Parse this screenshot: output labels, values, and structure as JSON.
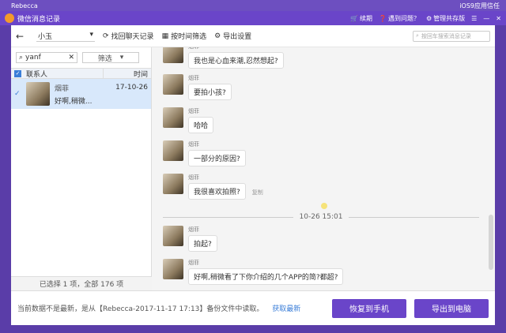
{
  "mac_bar": {
    "app": "Rebecca",
    "right_text": "iOS9应用信任"
  },
  "titlebar": {
    "title": "微信消息记录",
    "items": [
      {
        "label": "续期",
        "icon": "cart-icon"
      },
      {
        "label": "遇到问题？",
        "icon": "help-icon"
      },
      {
        "label": "管理共存版",
        "icon": "manage-icon"
      }
    ]
  },
  "toolbar": {
    "contact": "小玉",
    "retrieve_label": "找回聊天记录",
    "time_filter_label": "按时间筛选",
    "export_label": "导出设置",
    "search_placeholder": "按回车搜索消息记录"
  },
  "left": {
    "search_value": "yanf",
    "filter_label": "筛选",
    "col_contact": "联系人",
    "col_time": "时间",
    "rows": [
      {
        "name": "烟菲",
        "preview": "好啊,稍微...",
        "time": "17-10-26"
      }
    ],
    "footer": "已选择 1 项，全部 176 项"
  },
  "chat": {
    "divider_time": "10-26 15:01",
    "copy_label": "复制",
    "messages": [
      {
        "name": "烟菲",
        "text": "我也是心血来潮,忍然想起?"
      },
      {
        "name": "烟菲",
        "text": "要拍小孩?"
      },
      {
        "name": "烟菲",
        "text": "哈哈"
      },
      {
        "name": "烟菲",
        "text": "一部分的原因?"
      },
      {
        "name": "烟菲",
        "text": "我很喜欢拍照?"
      },
      {
        "name": "烟菲",
        "text": "拍起?"
      },
      {
        "name": "烟菲",
        "text": "好啊,稍微看了下你介绍的几个APP的简?都超?"
      }
    ]
  },
  "bottom": {
    "info": "当前数据不是最新，是从【Rebecca-2017-11-17 17:13】备份文件中读取。",
    "refresh_link": "获取最新",
    "restore_label": "恢复到手机",
    "export_label": "导出到电脑"
  },
  "colors": {
    "accent": "#6a45c9",
    "selected_row": "#d8e8fb"
  }
}
